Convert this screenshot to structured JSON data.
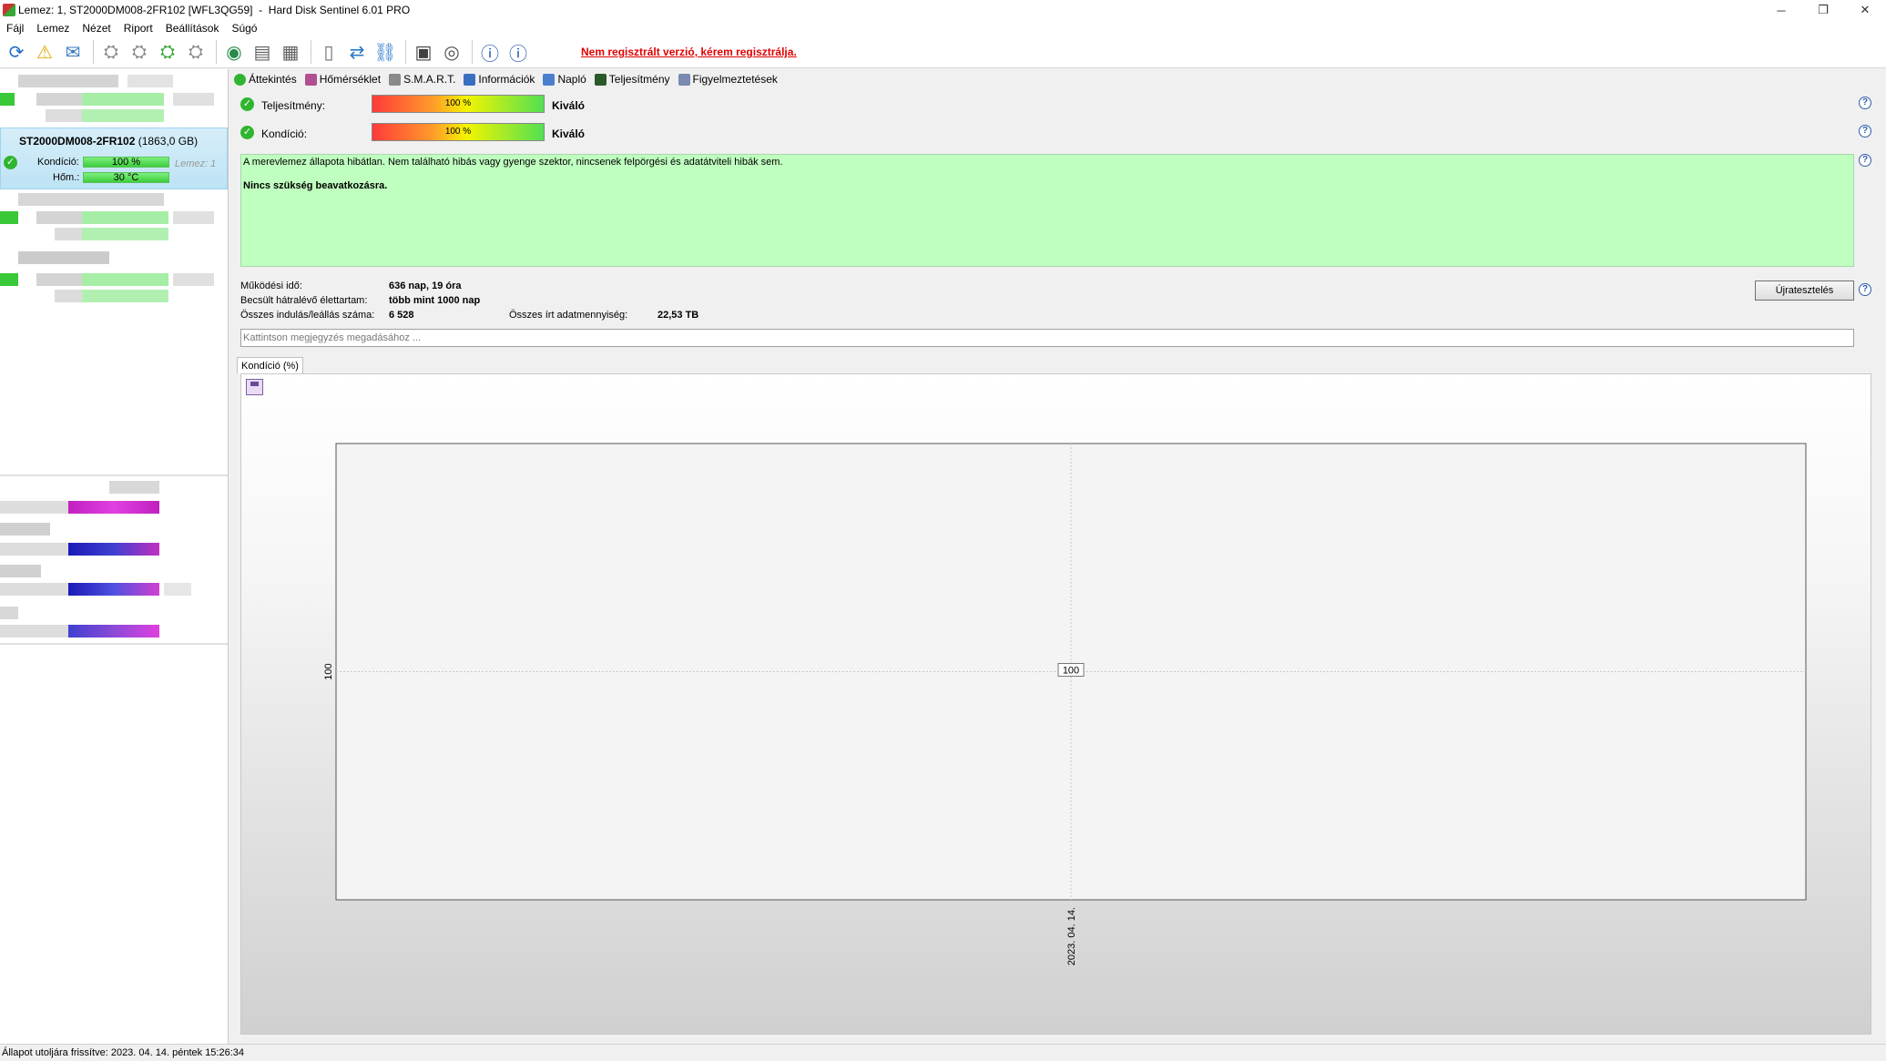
{
  "window": {
    "title": "Lemez: 1, ST2000DM008-2FR102 [WFL3QG59]  -  Hard Disk Sentinel 6.01 PRO",
    "minimize": "─",
    "restore": "❐",
    "close": "✕"
  },
  "menu": [
    "Fájl",
    "Lemez",
    "Nézet",
    "Riport",
    "Beállítások",
    "Súgó"
  ],
  "toolbar": {
    "register_link": "Nem regisztrált verzió, kérem regisztrálja."
  },
  "selected_disk": {
    "name": "ST2000DM008-2FR102",
    "size": "(1863,0 GB)",
    "condition_label": "Kondíció:",
    "condition_value": "100 %",
    "condition_fraction": 1.0,
    "temp_label": "Hőm.:",
    "temp_value": "30 °C",
    "disk_label": "Lemez: 1"
  },
  "tabs": [
    {
      "label": "Áttekintés",
      "icon": "check-icon",
      "color": "#2fb52f"
    },
    {
      "label": "Hőmérséklet",
      "icon": "thermometer-icon",
      "color": "#b05090"
    },
    {
      "label": "S.M.A.R.T.",
      "icon": "harddisk-icon",
      "color": "#8a8a8a"
    },
    {
      "label": "Információk",
      "icon": "info-anchor-icon",
      "color": "#3a6fc0"
    },
    {
      "label": "Napló",
      "icon": "log-icon",
      "color": "#4a7fd0"
    },
    {
      "label": "Teljesítmény",
      "icon": "gauge-icon",
      "color": "#2a5a2a"
    },
    {
      "label": "Figyelmeztetések",
      "icon": "alerts-icon",
      "color": "#7a8ab0"
    }
  ],
  "performance": {
    "label": "Teljesítmény:",
    "value": "100 %",
    "fraction": 1.0,
    "status": "Kiváló"
  },
  "condition": {
    "label": "Kondíció:",
    "value": "100 %",
    "fraction": 1.0,
    "status": "Kiváló"
  },
  "status_text": {
    "line1": "A merevlemez állapota hibátlan. Nem található hibás vagy gyenge szektor, nincsenek felpörgési és adatátviteli hibák sem.",
    "line2": "Nincs szükség beavatkozásra."
  },
  "info": {
    "uptime_label": "Működési idő:",
    "uptime_value": "636 nap, 19 óra",
    "remaining_label": "Becsült hátralévő élettartam:",
    "remaining_value": "több mint 1000 nap",
    "starts_label": "Összes indulás/leállás száma:",
    "starts_value": "6 528",
    "written_label": "Összes írt adatmennyiség:",
    "written_value": "22,53 TB"
  },
  "retest_button": "Újratesztelés",
  "note_placeholder": "Kattintson megjegyzés megadásához ...",
  "chart_tab": "Kondíció  (%)",
  "chart_data": {
    "type": "line",
    "x": [
      "2023. 04. 14."
    ],
    "y": [
      100
    ],
    "data_labels": [
      "100"
    ],
    "yticks": [
      "100"
    ],
    "title": "",
    "xlabel": "",
    "ylabel": ""
  },
  "statusbar": "Állapot utoljára frissítve: 2023. 04. 14. péntek 15:26:34"
}
